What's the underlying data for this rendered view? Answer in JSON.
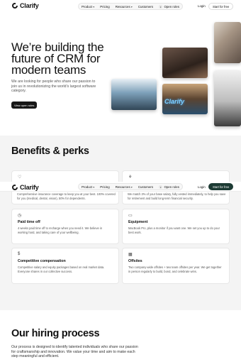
{
  "nav": {
    "brand": "Clarify",
    "items": [
      {
        "label": "Product",
        "dropdown": true
      },
      {
        "label": "Pricing",
        "dropdown": false
      },
      {
        "label": "Resources",
        "dropdown": true
      },
      {
        "label": "Customers",
        "dropdown": false
      }
    ],
    "open_roles_label": "Open roles",
    "open_roles_count": "",
    "login_label": "Login",
    "cta_label": "Start for free"
  },
  "hero": {
    "title": "We’re building the future of CRM for modern teams",
    "subtitle": "We are looking for people who share our passion to join us in revolutionizing the world’s largest software category.",
    "button_label": "View open roles",
    "photo_sign_text": "Clarify"
  },
  "benefits": {
    "title": "Benefits & perks",
    "cards": [
      {
        "icon": "heart-icon",
        "title": "",
        "desc": "Comprehensive insurance coverage to keep you at your best. 100% covered for you (medical, dental, vision), 50% for dependents."
      },
      {
        "icon": "handshake-icon",
        "title": "",
        "desc": "We match 3% of your base salary, fully vested immediately, to help you save for retirement and build long-term financial security."
      },
      {
        "icon": "clock-icon",
        "title": "Paid time off",
        "desc": "4 weeks paid time off to recharge when you need it. We believe in working hard, and taking care of your wellbeing."
      },
      {
        "icon": "laptop-icon",
        "title": "Equipment",
        "desc": "MacBook Pro, plus a monitor if you want one. We set you up to do your best work."
      },
      {
        "icon": "dollar-icon",
        "title": "Competitive compensation",
        "desc": "Competitive salary and equity packages based on real market data. Everyone shares in our collective success."
      },
      {
        "icon": "building-icon",
        "title": "Offsites",
        "desc": "Two company-wide offsites + two team offsites per year. We get together in person regularly to build, bond, and celebrate wins."
      }
    ]
  },
  "hiring": {
    "title": "Our hiring process",
    "text": "Our process is designed to identify talented individuals who share our passion for craftsmanship and innovation. We value your time and aim to make each step meaningful and efficient."
  }
}
